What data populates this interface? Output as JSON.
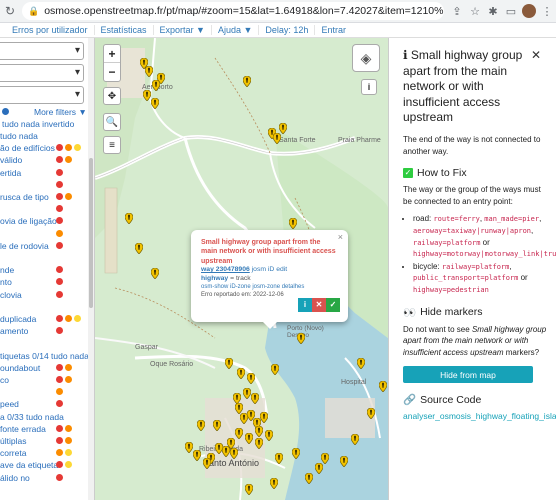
{
  "browser": {
    "url": "osmose.openstreetmap.fr/pt/map/#zoom=15&lat=1.64918&lon=7.42027&item=1210%2C9xxx&level=1&i..."
  },
  "menubar": {
    "items": [
      "Erros por utilizador",
      "Estatísticas",
      "Exportar ▼",
      "Ajuda ▼",
      "Delay: 12h",
      "Entrar"
    ]
  },
  "sidebar": {
    "more_filters": "More filters ▼",
    "select_all": "tudo nada invertido",
    "rows": [
      {
        "text": "tudo nada",
        "dots": []
      },
      {
        "text": "ão de edifícios",
        "dots": [
          "#e53935",
          "#fb8c00",
          "#fdd835"
        ]
      },
      {
        "text": "válido",
        "dots": [
          "#e53935",
          "#fb8c00"
        ]
      },
      {
        "text": "ertida",
        "dots": [
          "#e53935"
        ]
      },
      {
        "text": "",
        "dots": [
          "#e53935"
        ]
      },
      {
        "text": "rusca de tipo",
        "dots": [
          "#e53935",
          "#fb8c00"
        ]
      },
      {
        "text": "",
        "dots": [
          "#e53935"
        ]
      },
      {
        "text": "ovia de ligação",
        "dots": [
          "#e53935"
        ]
      },
      {
        "text": "",
        "dots": [
          "#fb8c00"
        ]
      },
      {
        "text": "le de rodovia",
        "dots": [
          "#e53935"
        ]
      },
      {
        "text": "",
        "dots": []
      },
      {
        "text": "nde",
        "dots": [
          "#e53935"
        ]
      },
      {
        "text": "nto",
        "dots": [
          "#e53935"
        ]
      },
      {
        "text": "clovia",
        "dots": [
          "#e53935"
        ]
      },
      {
        "text": "",
        "dots": []
      },
      {
        "text": "duplicada",
        "dots": [
          "#e53935",
          "#fb8c00",
          "#fdd835"
        ]
      },
      {
        "text": "amento",
        "dots": [
          "#e53935"
        ]
      },
      {
        "text": "",
        "dots": []
      },
      {
        "text": "tiquetas 0/14 tudo nada",
        "dots": []
      },
      {
        "text": "oundabout",
        "dots": [
          "#e53935",
          "#fb8c00"
        ]
      },
      {
        "text": "co",
        "dots": [
          "#e53935",
          "#fb8c00"
        ]
      },
      {
        "text": "",
        "dots": [
          "#fb8c00"
        ]
      },
      {
        "text": "peed",
        "dots": [
          "#e53935"
        ]
      },
      {
        "text": "a 0/33 tudo nada",
        "dots": []
      },
      {
        "text": "fonte errada",
        "dots": [
          "#e53935",
          "#fb8c00"
        ]
      },
      {
        "text": "últiplas",
        "dots": [
          "#e53935",
          "#fb8c00"
        ]
      },
      {
        "text": "correta",
        "dots": [
          "#fb8c00",
          "#fdd835"
        ]
      },
      {
        "text": "ave da etiqueta",
        "dots": [
          "#e53935",
          "#fdd835"
        ]
      },
      {
        "text": "álido no",
        "dots": [
          "#e53935"
        ]
      }
    ]
  },
  "map": {
    "labels": {
      "aeroporto": "Aeroporto",
      "santa_forte": "Santa Forte",
      "praia_pharme": "Praia Pharme",
      "gaspar": "Gaspar",
      "oque_rosario": "Oque Rosário",
      "ribeira_funda": "Ribeira Funda",
      "santo_antonio": "Santo António",
      "hospital": "Hospital",
      "porto_novo": "Porto (Novo)\nDestino"
    }
  },
  "popup": {
    "title": "Small highway group apart from the main network or with insufficient access upstream",
    "way_link": "way 230478906",
    "edit_links": [
      "josm",
      "iD",
      "edit"
    ],
    "tag_key": "highway",
    "tag_value": "track",
    "sub_links": "osm-show iD-zone josm-zone detalhes",
    "reported": "Erro reportado em: 2022-12-06",
    "btn_colors": {
      "info": "#17a2b8",
      "false": "#d9534f",
      "done": "#28a745"
    }
  },
  "panel": {
    "title": "Small highway group apart from the main network or with insufficient access upstream",
    "description": "The end of the way is not connected to another way.",
    "howto_title": "How to Fix",
    "howto_text": "The way or the group of the ways must be connected to an entry point:",
    "road_label": "road:",
    "road_code1": "route=ferry",
    "road_code2": "man_made=pier",
    "road_code3": "aeroway=taxiway|runway|apron",
    "road_code4": "railway=platform",
    "road_code5": "highway=motorway|motorway_link|trunk|trunk_link|primary|primary_link",
    "or": "or",
    "or2": "or",
    "or3": "or",
    "or4": "or",
    "bicycle_label": "bicycle:",
    "bicycle_code1": "railway=platform",
    "bicycle_code2": "public_transport=platform",
    "bicycle_code3": "highway=pedestrian",
    "hide_title": "Hide markers",
    "hide_text1": "Do not want to see ",
    "hide_text_em": "Small highway group apart from the main network or with insufficient access upstream",
    "hide_text2": " markers?",
    "hide_button": "Hide from map",
    "source_title": "Source Code",
    "source_link": "analyser_osmosis_highway_floating_islands"
  }
}
